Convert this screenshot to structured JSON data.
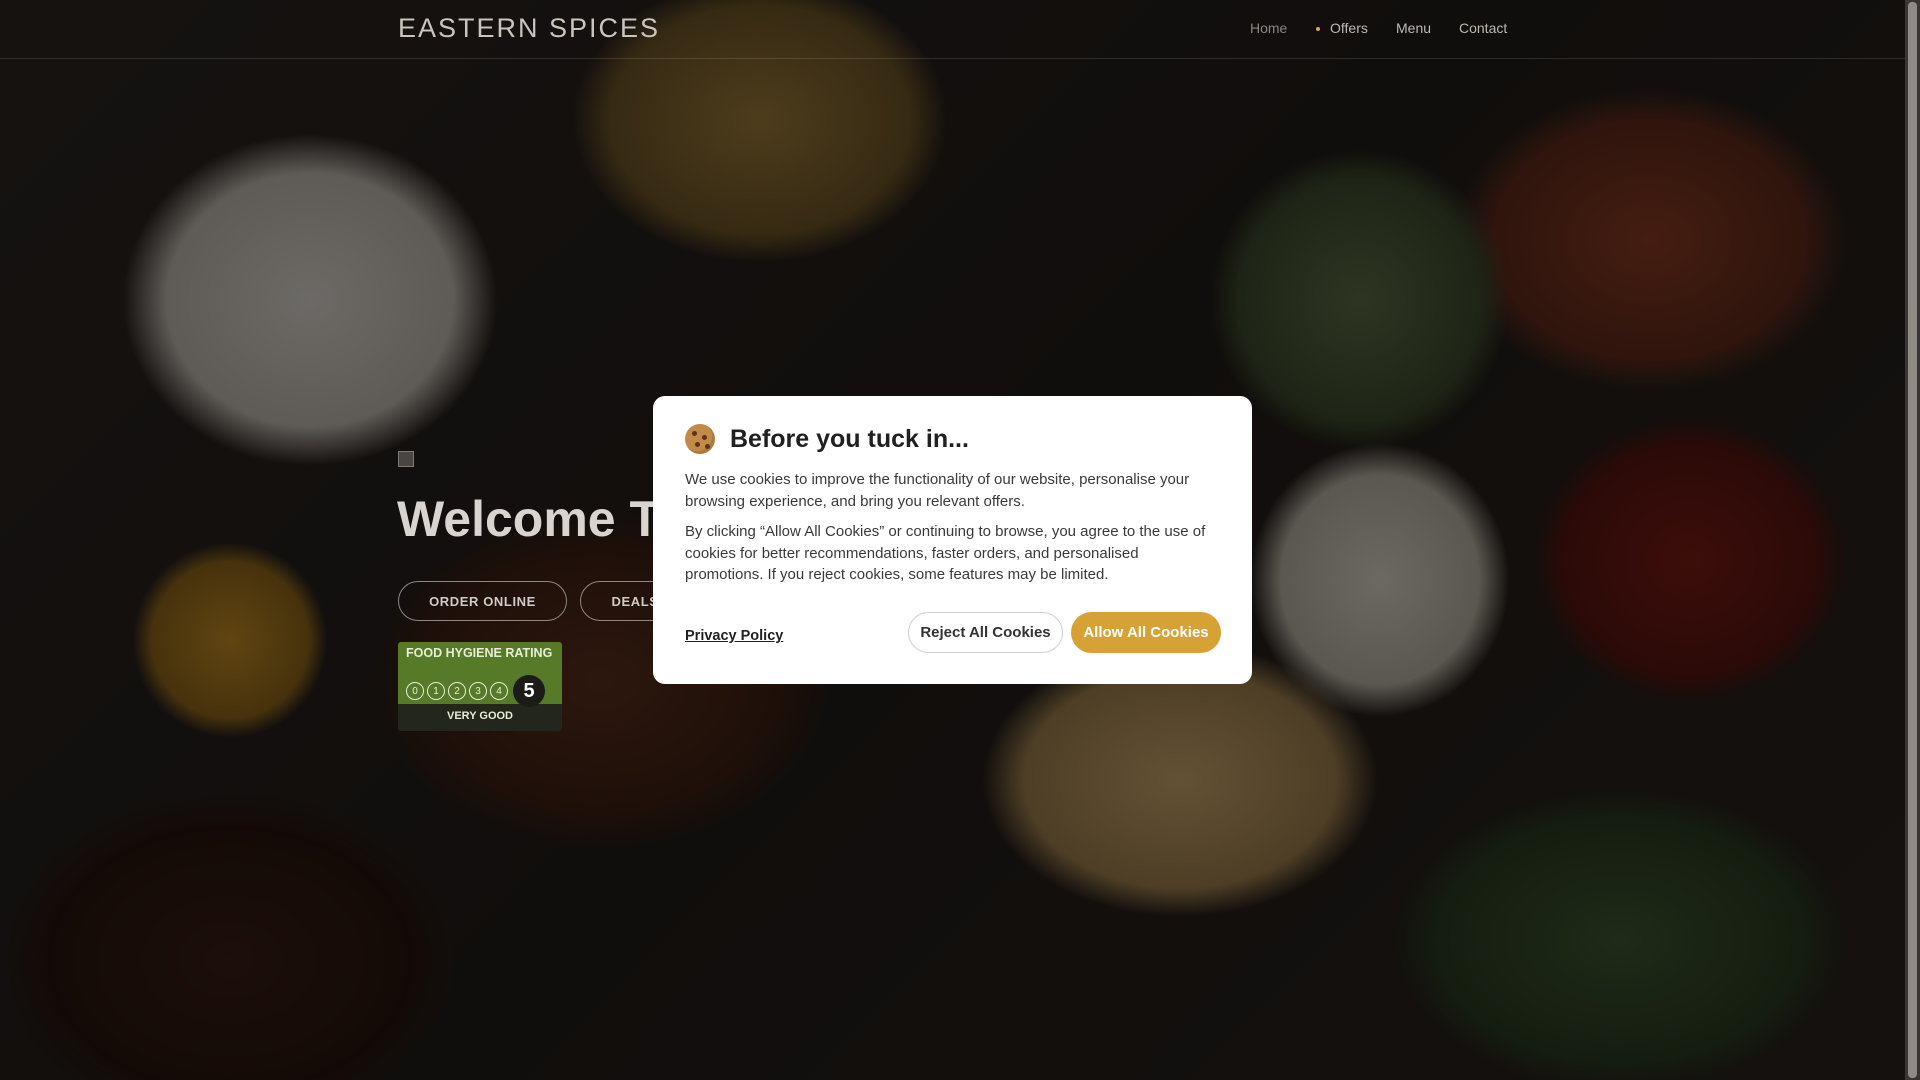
{
  "brand": "EASTERN SPICES",
  "nav": {
    "home": "Home",
    "offers": "Offers",
    "menu": "Menu",
    "contact": "Contact"
  },
  "hero": {
    "title": "Welcome To Eastern Spices",
    "order_label": "ORDER ONLINE",
    "deals_label": "DEALS"
  },
  "hygiene_badge": {
    "title": "FOOD HYGIENE RATING",
    "scale": [
      "0",
      "1",
      "2",
      "3",
      "4"
    ],
    "rating": "5",
    "caption": "VERY GOOD"
  },
  "cookie_modal": {
    "icon": "cookie-icon",
    "title": "Before you tuck in...",
    "paragraph1": "We use cookies to improve the functionality of our website, personalise your browsing experience, and bring you relevant offers.",
    "paragraph2": "By clicking “Allow All Cookies” or continuing to browse, you agree to the use of cookies for better recommendations, faster orders, and personalised promotions. If you reject cookies, some features may be limited.",
    "privacy_label": "Privacy Policy",
    "reject_label": "Reject All Cookies",
    "allow_label": "Allow All Cookies"
  },
  "colors": {
    "accent": "#d6a236",
    "hygiene_green": "#567a28"
  }
}
